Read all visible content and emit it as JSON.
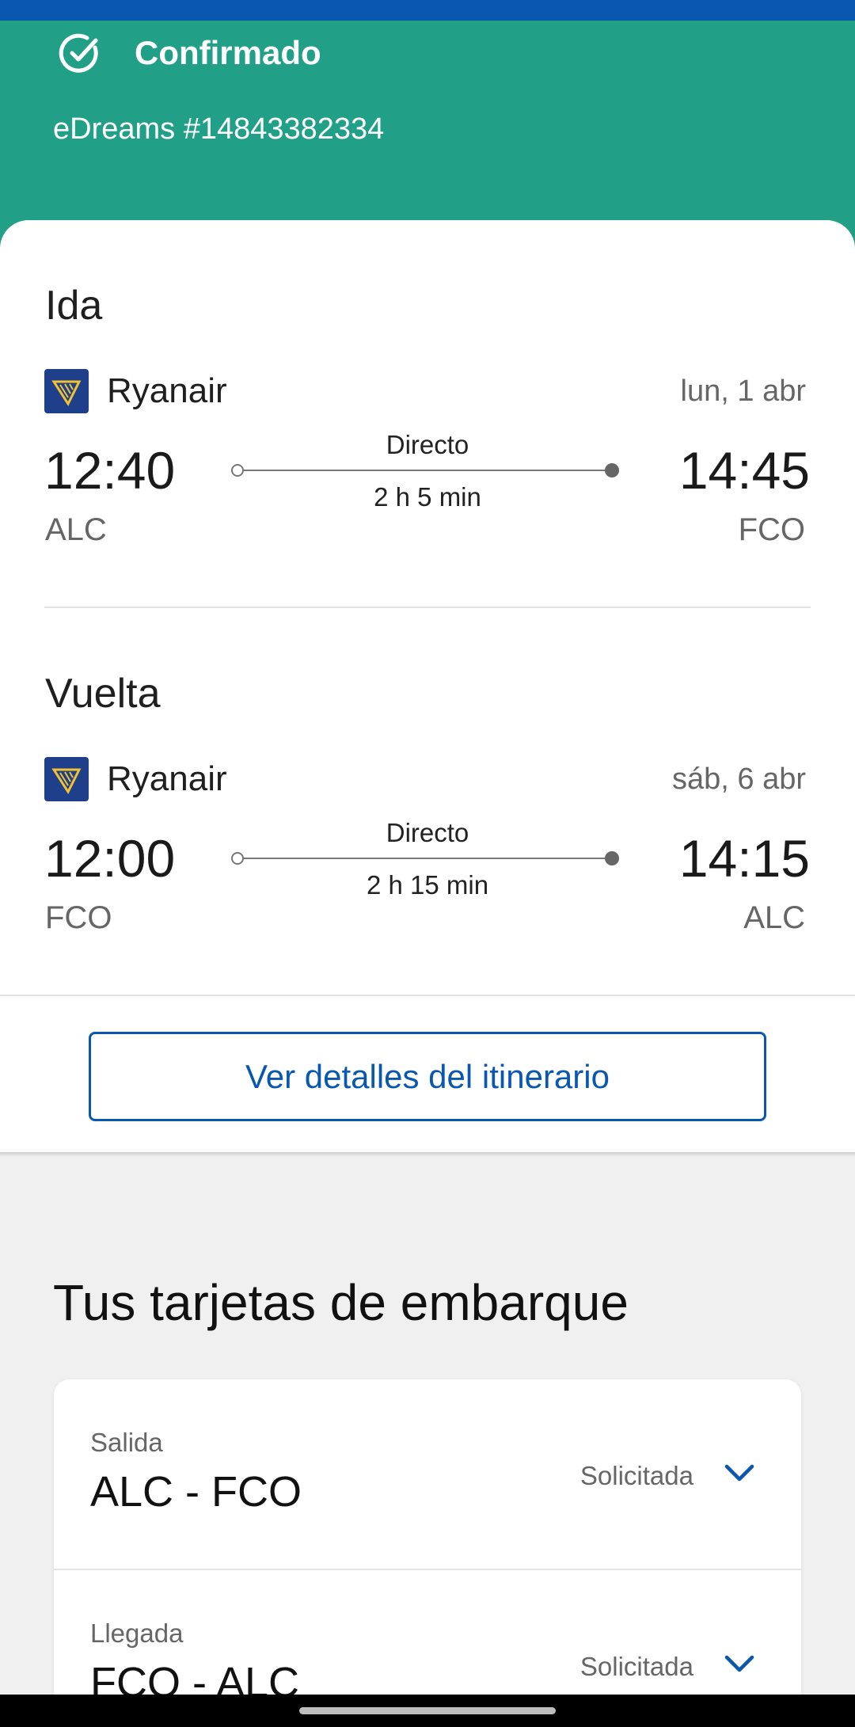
{
  "header": {
    "status": "Confirmado",
    "booking_ref": "eDreams #14843382334"
  },
  "legs": [
    {
      "title": "Ida",
      "airline": "Ryanair",
      "date": "lun, 1 abr",
      "dep_time": "12:40",
      "arr_time": "14:45",
      "dep_code": "ALC",
      "arr_code": "FCO",
      "stops": "Directo",
      "duration": "2 h 5 min"
    },
    {
      "title": "Vuelta",
      "airline": "Ryanair",
      "date": "sáb, 6 abr",
      "dep_time": "12:00",
      "arr_time": "14:15",
      "dep_code": "FCO",
      "arr_code": "ALC",
      "stops": "Directo",
      "duration": "2 h 15 min"
    }
  ],
  "details_button": "Ver detalles del itinerario",
  "boarding": {
    "title": "Tus tarjetas de embarque",
    "items": [
      {
        "kind": "Salida",
        "route": "ALC - FCO",
        "state": "Solicitada"
      },
      {
        "kind": "Llegada",
        "route": "FCO - ALC",
        "state": "Solicitada"
      }
    ]
  },
  "colors": {
    "header_green": "#21a087",
    "accent_blue": "#0a57b0",
    "airline_logo_bg": "#1f3f8a",
    "airline_logo_fg": "#f2c230"
  },
  "icons": {
    "status": "check-circle-icon",
    "airline": "ryanair-harp-icon",
    "expand": "chevron-down-icon"
  }
}
